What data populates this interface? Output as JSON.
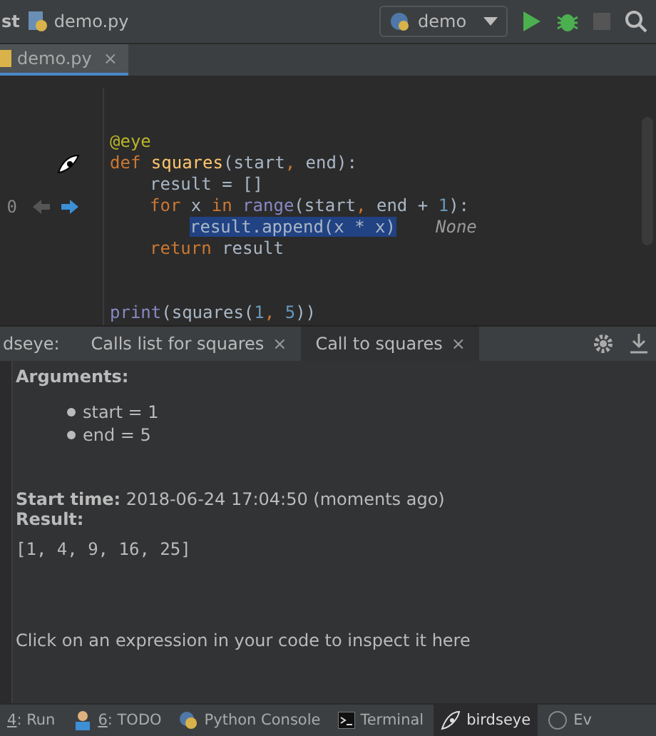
{
  "toolbar": {
    "breadcrumbs": [
      "st",
      "demo.py"
    ],
    "run_config": "demo"
  },
  "editor_tabs": [
    {
      "label": "demo.py",
      "close": "×",
      "selected": true
    }
  ],
  "gutter": {
    "line_number": "0"
  },
  "code_lines": [
    {
      "kind": "blank"
    },
    {
      "kind": "blank"
    },
    {
      "kind": "code",
      "segments": [
        {
          "kind": "decorator",
          "text": "@eye"
        }
      ]
    },
    {
      "kind": "code",
      "segments": [
        {
          "kind": "keyword",
          "text": "def "
        },
        {
          "kind": "name",
          "text": "squares"
        },
        {
          "kind": "plain",
          "text": "(start"
        },
        {
          "kind": "keyword",
          "text": ", "
        },
        {
          "kind": "plain",
          "text": "end):"
        }
      ],
      "children": [
        {
          "kind": "code",
          "segments": [
            {
              "kind": "plain",
              "text": "result = []"
            }
          ]
        },
        {
          "kind": "code",
          "segments": [
            {
              "kind": "keyword",
              "text": "for "
            },
            {
              "kind": "plain",
              "text": "x "
            },
            {
              "kind": "keyword",
              "text": "in "
            },
            {
              "kind": "builtin",
              "text": "range"
            },
            {
              "kind": "plain",
              "text": "(start"
            },
            {
              "kind": "keyword",
              "text": ", "
            },
            {
              "kind": "plain",
              "text": "end + "
            },
            {
              "kind": "number",
              "text": "1"
            },
            {
              "kind": "plain",
              "text": "):"
            }
          ],
          "children": [
            {
              "kind": "code",
              "segments": [
                {
                  "kind": "selection",
                  "text": "result.append(x * x)"
                },
                {
                  "kind": "hint",
                  "text": "None"
                }
              ]
            }
          ]
        },
        {
          "kind": "code",
          "segments": [
            {
              "kind": "keyword",
              "text": "return "
            },
            {
              "kind": "plain",
              "text": "result"
            }
          ]
        }
      ]
    },
    {
      "kind": "blank"
    },
    {
      "kind": "blank"
    },
    {
      "kind": "code",
      "segments": [
        {
          "kind": "builtin",
          "text": "print"
        },
        {
          "kind": "plain",
          "text": "(squares("
        },
        {
          "kind": "number",
          "text": "1"
        },
        {
          "kind": "keyword",
          "text": ", "
        },
        {
          "kind": "number",
          "text": "5"
        },
        {
          "kind": "plain",
          "text": "))"
        }
      ]
    }
  ],
  "panel": {
    "title": "dseye:",
    "tabs": [
      {
        "label": "Calls list for squares",
        "close": "×",
        "selected": false
      },
      {
        "label": "Call to squares",
        "close": "×",
        "selected": true
      }
    ],
    "arguments_label": "Arguments:",
    "arguments": [
      "start = 1",
      "end = 5"
    ],
    "start_time_label": "Start time:",
    "start_time": "2018-06-24 17:04:50 (moments ago)",
    "result_label": "Result:",
    "result": "[1, 4, 9, 16, 25]",
    "hint": "Click on an expression in your code to inspect it here"
  },
  "bottom_tabs": [
    {
      "key": "4",
      "label": ": Run",
      "selected": false
    },
    {
      "key": "6",
      "label": ": TODO",
      "selected": false
    },
    {
      "label": "Python Console",
      "selected": false
    },
    {
      "label": "Terminal",
      "selected": false
    },
    {
      "label": "birdseye",
      "selected": true
    },
    {
      "label": "Ev",
      "selected": false
    }
  ]
}
